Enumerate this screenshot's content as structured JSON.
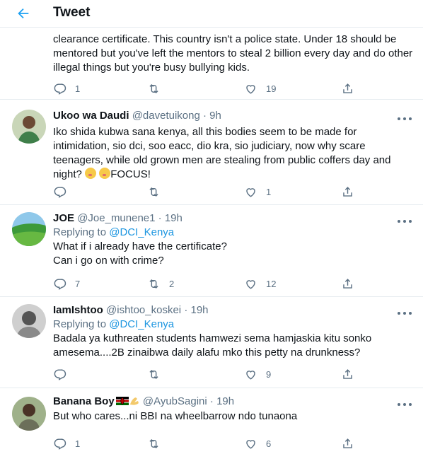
{
  "header": {
    "title": "Tweet",
    "back_icon": "arrow-left-icon",
    "accent": "#1da1f2"
  },
  "tweets": [
    {
      "text": "clearance certificate. This country isn't a police state. Under 18 should be mentored but you've left the mentors to steal 2 billion every day and do other illegal things but you're busy bullying kids.",
      "replies": "1",
      "retweets": "",
      "likes": "19"
    },
    {
      "name": "Ukoo wa Daudi",
      "handle": "@davetuikong",
      "dot": "·",
      "time": "9h",
      "text": "Iko shida kubwa sana kenya, all this bodies seem to be made for intimidation, sio dci, soo eacc, dio kra, sio judiciary, now why scare teenagers, while old grown men are stealing from public coffers day and night?",
      "text_tail": "FOCUS!",
      "replies": "",
      "retweets": "",
      "likes": "1"
    },
    {
      "name": "JOE",
      "handle": "@Joe_munene1",
      "dot": "·",
      "time": "19h",
      "replying_prefix": "Replying to",
      "replying_to": "@DCI_Kenya",
      "text_lines": [
        "What if i already have the certificate?",
        "Can i go on with crime?"
      ],
      "replies": "7",
      "retweets": "2",
      "likes": "12"
    },
    {
      "name": "IamIshtoo",
      "handle": "@ishtoo_koskei",
      "dot": "·",
      "time": "19h",
      "replying_prefix": "Replying to",
      "replying_to": "@DCI_Kenya",
      "text": "Badala ya kuthreaten students hamwezi sema hamjaskia kitu sonko amesema....2B zinaibwa daily alafu mko this petty na drunkness?",
      "replies": "",
      "retweets": "",
      "likes": "9"
    },
    {
      "name": "Banana Boy",
      "handle": "@AyubSagini",
      "dot": "·",
      "time": "19h",
      "text": "But who cares...ni BBI na wheelbarrow ndo tunaona",
      "replies": "1",
      "retweets": "",
      "likes": "6"
    }
  ]
}
